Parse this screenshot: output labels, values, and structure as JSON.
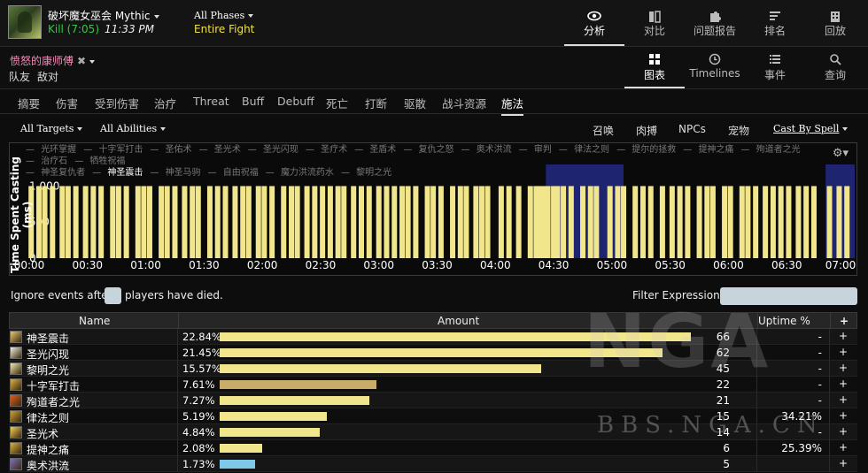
{
  "header": {
    "boss_name": "破坏魔女巫会 Mythic",
    "kill_label": "Kill (7:05)",
    "kill_time": "11:33 PM",
    "phase_label": "All Phases",
    "phase_value": "Entire Fight",
    "nav": [
      {
        "label": "分析",
        "icon": "eye-icon"
      },
      {
        "label": "对比",
        "icon": "compare-icon"
      },
      {
        "label": "问题报告",
        "icon": "puzzle-icon"
      },
      {
        "label": "排名",
        "icon": "rank-bars-icon"
      },
      {
        "label": "回放",
        "icon": "replay-icon"
      }
    ]
  },
  "player_bar": {
    "player_name": "愤怒的康师傅",
    "team_labels": [
      "队友",
      "敌对"
    ],
    "views": [
      {
        "label": "图表",
        "icon": "grid-icon"
      },
      {
        "label": "Timelines",
        "icon": "clock-icon"
      },
      {
        "label": "事件",
        "icon": "list-icon"
      },
      {
        "label": "查询",
        "icon": "search-icon"
      }
    ]
  },
  "tabs": [
    "摘要",
    "伤害",
    "受到伤害",
    "治疗",
    "Threat",
    "Buff",
    "Debuff",
    "死亡",
    "打断",
    "驱散",
    "战斗资源",
    "施法"
  ],
  "active_tab": 11,
  "filters": {
    "targets": "All Targets",
    "abilities": "All Abilities",
    "right": [
      "召唤",
      "肉搏",
      "NPCs",
      "宠物"
    ],
    "cast_by": "Cast By Spell"
  },
  "legend": {
    "line1": [
      "光环掌握",
      "十字军打击",
      "圣佑术",
      "圣光术",
      "圣光闪现",
      "圣疗术",
      "圣盾术",
      "复仇之怒",
      "奥术洪流",
      "审判",
      "律法之则",
      "提尔的拯救",
      "提神之痛",
      "殉道者之光",
      "治疗石",
      "牺牲祝福"
    ],
    "line2": [
      "神圣复仇者",
      "神圣震击",
      "神圣马驹",
      "自由祝福",
      "魔力洪流药水",
      "黎明之光"
    ],
    "selected": "神圣震击"
  },
  "chart_data": {
    "type": "bar",
    "ylabel": "Time Spent Casting (ms)",
    "ylim": [
      0,
      1300
    ],
    "yticks": [
      "0",
      "500",
      "1,000"
    ],
    "xticks": [
      "00:00",
      "00:30",
      "01:00",
      "01:30",
      "02:00",
      "02:30",
      "03:00",
      "03:30",
      "04:00",
      "04:30",
      "05:00",
      "05:30",
      "06:00",
      "06:30",
      "07:00"
    ],
    "x_range_sec": [
      0,
      425
    ],
    "highlight_ranges_sec": [
      [
        266,
        306
      ],
      [
        410,
        425
      ]
    ],
    "bar_color": "#f2e68c",
    "highlight_color": "#1e2470",
    "cast_times_sec": [
      1,
      5,
      8,
      12,
      17,
      20,
      24,
      29,
      33,
      37,
      43,
      46,
      50,
      56,
      59,
      62,
      68,
      71,
      75,
      80,
      84,
      87,
      93,
      97,
      101,
      106,
      110,
      113,
      118,
      121,
      125,
      131,
      135,
      138,
      143,
      147,
      151,
      155,
      159,
      162,
      167,
      171,
      175,
      180,
      184,
      188,
      192,
      195,
      199,
      205,
      208,
      212,
      218,
      222,
      225,
      230,
      233,
      236,
      243,
      247,
      252,
      258,
      261,
      263,
      265,
      267,
      270,
      272,
      275,
      279,
      285,
      289,
      292,
      299,
      303,
      306,
      312,
      316,
      320,
      326,
      331,
      335,
      339,
      345,
      349,
      352,
      358,
      361,
      367,
      370,
      374,
      379,
      383,
      387,
      391,
      396,
      400,
      404,
      412,
      417,
      421
    ],
    "cast_values_ms": 1000
  },
  "controls": {
    "ignore_label_before": "Ignore events after",
    "ignore_label_after": "players have died.",
    "filter_label": "Filter Expression:"
  },
  "table": {
    "headers": [
      "Name",
      "Amount",
      "Uptime %",
      "+"
    ],
    "rows": [
      {
        "name": "神圣震击",
        "pct": "22.84%",
        "value": 22.84,
        "count": "66",
        "uptime": "-",
        "bar_color": "#f2e68c",
        "icon_color": "#e8c870"
      },
      {
        "name": "圣光闪现",
        "pct": "21.45%",
        "value": 21.45,
        "count": "62",
        "uptime": "-",
        "bar_color": "#f2e68c",
        "icon_color": "#f0f0e0"
      },
      {
        "name": "黎明之光",
        "pct": "15.57%",
        "value": 15.57,
        "count": "45",
        "uptime": "-",
        "bar_color": "#f2e68c",
        "icon_color": "#f4e8b0"
      },
      {
        "name": "十字军打击",
        "pct": "7.61%",
        "value": 7.61,
        "count": "22",
        "uptime": "-",
        "bar_color": "#c8ad6a",
        "icon_color": "#e0b040"
      },
      {
        "name": "殉道者之光",
        "pct": "7.27%",
        "value": 7.27,
        "count": "21",
        "uptime": "-",
        "bar_color": "#f2e68c",
        "icon_color": "#e06020"
      },
      {
        "name": "律法之则",
        "pct": "5.19%",
        "value": 5.19,
        "count": "15",
        "uptime": "34.21%",
        "bar_color": "#f2e68c",
        "icon_color": "#d0a030"
      },
      {
        "name": "圣光术",
        "pct": "4.84%",
        "value": 4.84,
        "count": "14",
        "uptime": "-",
        "bar_color": "#f2e68c",
        "icon_color": "#f8d050"
      },
      {
        "name": "提神之痛",
        "pct": "2.08%",
        "value": 2.08,
        "count": "6",
        "uptime": "25.39%",
        "bar_color": "#f2e68c",
        "icon_color": "#d8b040"
      },
      {
        "name": "奥术洪流",
        "pct": "1.73%",
        "value": 1.73,
        "count": "5",
        "uptime": "",
        "bar_color": "#7ec8e8",
        "icon_color": "#8070c0"
      }
    ],
    "max_value": 22.84
  },
  "watermark": {
    "logo_text": "NGA",
    "url_text": "BBS.NGA.CN"
  }
}
